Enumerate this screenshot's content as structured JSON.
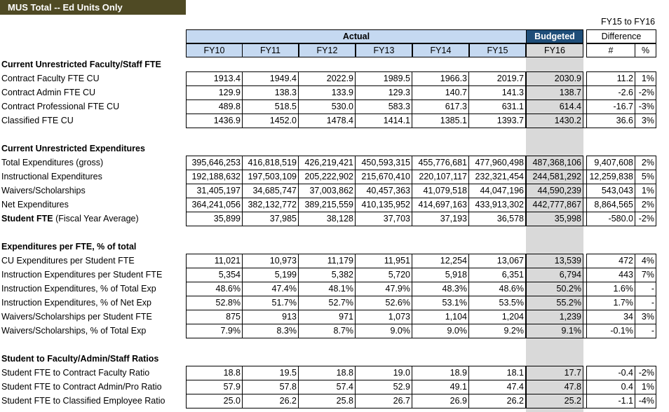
{
  "sheet_title": "MUS Total -- Ed Units Only",
  "header": {
    "diff_title": "FY15 to FY16",
    "actual": "Actual",
    "budgeted": "Budgeted",
    "difference": "Difference",
    "years": [
      "FY10",
      "FY11",
      "FY12",
      "FY13",
      "FY14",
      "FY15"
    ],
    "budget_year": "FY16",
    "num": "#",
    "pct": "%"
  },
  "sections": [
    {
      "title": "Current Unrestricted Faculty/Staff FTE",
      "rows": [
        {
          "label": "Contract Faculty FTE CU",
          "values": [
            "1913.4",
            "1949.4",
            "2022.9",
            "1989.5",
            "1966.3",
            "2019.7",
            "2030.9"
          ],
          "diff": "11.2",
          "pct": "1%"
        },
        {
          "label": "Contract Admin FTE CU",
          "values": [
            "129.9",
            "138.3",
            "133.9",
            "129.3",
            "140.7",
            "141.3",
            "138.7"
          ],
          "diff": "-2.6",
          "pct": "-2%"
        },
        {
          "label": "Contract Professional FTE CU",
          "values": [
            "489.8",
            "518.5",
            "530.0",
            "583.3",
            "617.3",
            "631.1",
            "614.4"
          ],
          "diff": "-16.7",
          "pct": "-3%"
        },
        {
          "label": "Classified FTE CU",
          "values": [
            "1436.9",
            "1452.0",
            "1478.4",
            "1414.1",
            "1385.1",
            "1393.7",
            "1430.2"
          ],
          "diff": "36.6",
          "pct": "3%"
        }
      ]
    },
    {
      "title": "Current Unrestricted Expenditures",
      "rows": [
        {
          "label": "Total Expenditures (gross)",
          "values": [
            "395,646,253",
            "416,818,519",
            "426,219,421",
            "450,593,315",
            "455,776,681",
            "477,960,498",
            "487,368,106"
          ],
          "diff": "9,407,608",
          "pct": "2%"
        },
        {
          "label": "Instructional Expenditures",
          "values": [
            "192,188,632",
            "197,503,109",
            "205,222,902",
            "215,670,410",
            "220,107,117",
            "232,321,454",
            "244,581,292"
          ],
          "diff": "12,259,838",
          "pct": "5%"
        },
        {
          "label": "Waivers/Scholarships",
          "values": [
            "31,405,197",
            "34,685,747",
            "37,003,862",
            "40,457,363",
            "41,079,518",
            "44,047,196",
            "44,590,239"
          ],
          "diff": "543,043",
          "pct": "1%"
        },
        {
          "label": "Net Expenditures",
          "values": [
            "364,241,056",
            "382,132,772",
            "389,215,559",
            "410,135,952",
            "414,697,163",
            "433,913,302",
            "442,777,867"
          ],
          "diff": "8,864,565",
          "pct": "2%"
        },
        {
          "label": "Student FTE",
          "label_suffix": " (Fiscal Year Average)",
          "values": [
            "35,899",
            "37,985",
            "38,128",
            "37,703",
            "37,193",
            "36,578",
            "35,998"
          ],
          "diff": "-580.0",
          "pct": "-2%"
        }
      ]
    },
    {
      "title": "Expenditures per FTE, % of total",
      "rows": [
        {
          "label": "CU Expenditures per Student FTE",
          "values": [
            "11,021",
            "10,973",
            "11,179",
            "11,951",
            "12,254",
            "13,067",
            "13,539"
          ],
          "diff": "472",
          "pct": "4%"
        },
        {
          "label": "Instruction Expenditures per Student FTE",
          "values": [
            "5,354",
            "5,199",
            "5,382",
            "5,720",
            "5,918",
            "6,351",
            "6,794"
          ],
          "diff": "443",
          "pct": "7%"
        },
        {
          "label": "Instruction Expenditures, % of Total Exp",
          "values": [
            "48.6%",
            "47.4%",
            "48.1%",
            "47.9%",
            "48.3%",
            "48.6%",
            "50.2%"
          ],
          "diff": "1.6%",
          "pct": "-"
        },
        {
          "label": "Instruction Expenditures, % of Net Exp",
          "values": [
            "52.8%",
            "51.7%",
            "52.7%",
            "52.6%",
            "53.1%",
            "53.5%",
            "55.2%"
          ],
          "diff": "1.7%",
          "pct": "-"
        },
        {
          "label": "Waivers/Scholarships per Student FTE",
          "values": [
            "875",
            "913",
            "971",
            "1,073",
            "1,104",
            "1,204",
            "1,239"
          ],
          "diff": "34",
          "pct": "3%"
        },
        {
          "label": "Waivers/Scholarships, % of Total Exp",
          "values": [
            "7.9%",
            "8.3%",
            "8.7%",
            "9.0%",
            "9.0%",
            "9.2%",
            "9.1%"
          ],
          "diff": "-0.1%",
          "pct": "-"
        }
      ]
    },
    {
      "title": "Student to Faculty/Admin/Staff Ratios",
      "rows": [
        {
          "label": "Student FTE to Contract Faculty Ratio",
          "values": [
            "18.8",
            "19.5",
            "18.8",
            "19.0",
            "18.9",
            "18.1",
            "17.7"
          ],
          "diff": "-0.4",
          "pct": "-2%"
        },
        {
          "label": "Student FTE to Contract Admin/Pro Ratio",
          "values": [
            "57.9",
            "57.8",
            "57.4",
            "52.9",
            "49.1",
            "47.4",
            "47.8"
          ],
          "diff": "0.4",
          "pct": "1%"
        },
        {
          "label": "Student FTE to Classified Employee Ratio",
          "values": [
            "25.0",
            "26.2",
            "25.8",
            "26.7",
            "26.9",
            "26.2",
            "25.2"
          ],
          "diff": "-1.1",
          "pct": "-4%"
        }
      ]
    }
  ]
}
